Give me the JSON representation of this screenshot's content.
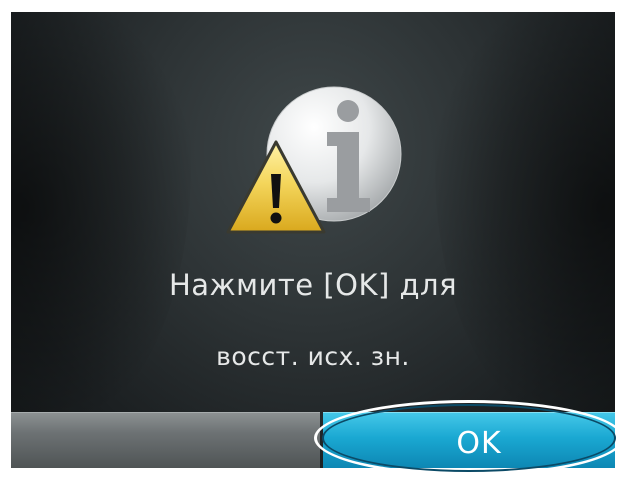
{
  "dialog": {
    "message_line_1": "Нажмите [OK] для",
    "message_line_2": "восст. исх. зн.",
    "icons": {
      "info": "info-icon",
      "warning": "warning-icon"
    }
  },
  "softkeys": {
    "left_label": "",
    "right_label": "OK"
  },
  "colors": {
    "screen_background": "#2d3335",
    "text": "#e6e8e8",
    "ok_button": "#1aa8d2",
    "left_softkey": "#6d7274",
    "warning_triangle": "#f2d25a",
    "info_circle": "#e4e6e7",
    "info_glyph": "#9a9da0"
  }
}
